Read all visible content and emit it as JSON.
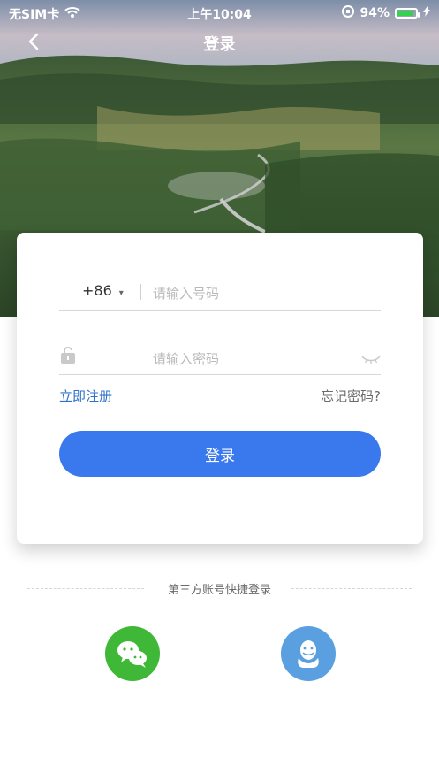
{
  "status_bar": {
    "carrier": "无SIM卡",
    "time": "上午10:04",
    "battery_text": "94%",
    "battery_level": 0.94,
    "battery_fill_color": "#33d34b",
    "icons": [
      "wifi-icon",
      "orientation-lock-icon",
      "battery-icon",
      "charging-icon"
    ]
  },
  "nav": {
    "title": "登录",
    "back_icon": "chevron-left-icon"
  },
  "form": {
    "country_code": "+86",
    "phone_placeholder": "请输入号码",
    "password_placeholder": "请输入密码",
    "register_link": "立即注册",
    "forgot_link": "忘记密码?",
    "login_button": "登录",
    "icons": [
      "lock-icon",
      "eye-closed-icon",
      "caret-down-icon"
    ]
  },
  "third_party": {
    "label": "第三方账号快捷登录",
    "providers": [
      {
        "name": "wechat",
        "icon": "wechat-icon",
        "color": "#3fb838"
      },
      {
        "name": "qq",
        "icon": "qq-icon",
        "color": "#5aa0e0"
      }
    ]
  },
  "colors": {
    "accent": "#3a78ee",
    "link": "#2d71c9"
  }
}
